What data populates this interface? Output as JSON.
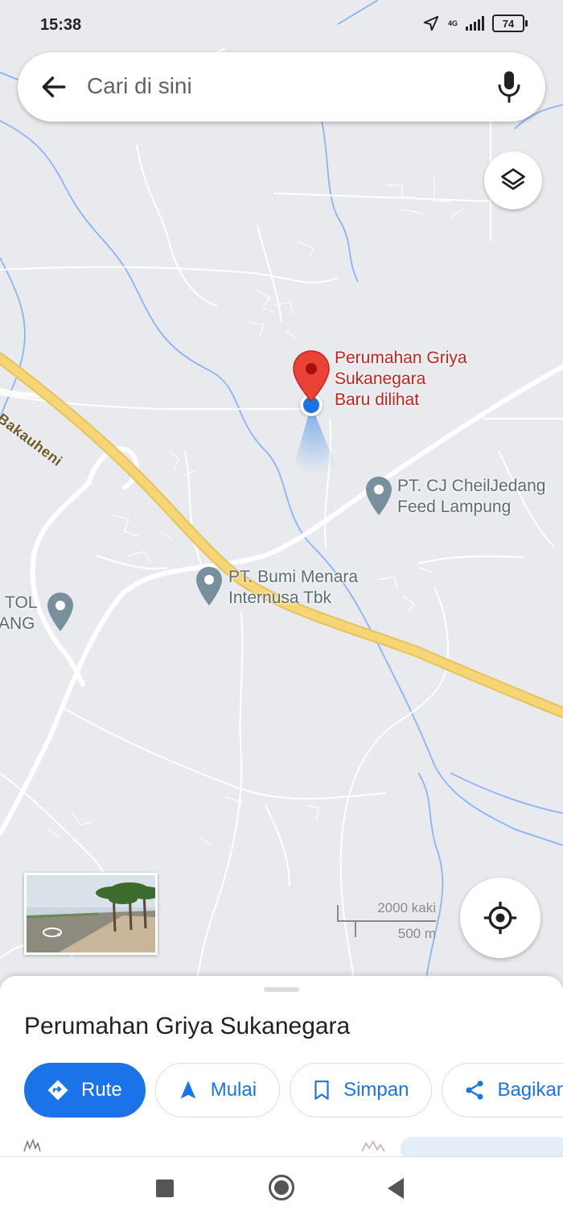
{
  "status_bar": {
    "time": "15:38",
    "network": "4G",
    "battery": "74"
  },
  "search": {
    "placeholder": "Cari di sini"
  },
  "map": {
    "selected_place": {
      "name_line1": "Perumahan Griya",
      "name_line2": "Sukanegara",
      "subtitle": "Baru dilihat"
    },
    "pois": [
      {
        "line1": "PT. CJ CheilJedang",
        "line2": "Feed Lampung"
      },
      {
        "line1": "PT. Bumi Menara",
        "line2": "Internusa Tbk"
      },
      {
        "line1": "TOL",
        "line2": "ANG"
      }
    ],
    "road_label": "g - Bakauheni",
    "scale": {
      "imperial": "2000 kaki",
      "metric": "500 m"
    },
    "colors": {
      "highway": "#f6d576",
      "road": "#ffffff",
      "water": "#8ab4f8",
      "land": "#e8eaed",
      "pin": "#ea4335",
      "location_dot": "#1a73e8"
    }
  },
  "sheet": {
    "title": "Perumahan Griya Sukanegara",
    "actions": [
      {
        "label": "Rute",
        "icon": "directions-icon"
      },
      {
        "label": "Mulai",
        "icon": "navigation-arrow-icon"
      },
      {
        "label": "Simpan",
        "icon": "bookmark-icon"
      },
      {
        "label": "Bagikan",
        "icon": "share-icon"
      }
    ]
  },
  "nav_bar": {
    "buttons": [
      "recents",
      "home",
      "back"
    ]
  }
}
